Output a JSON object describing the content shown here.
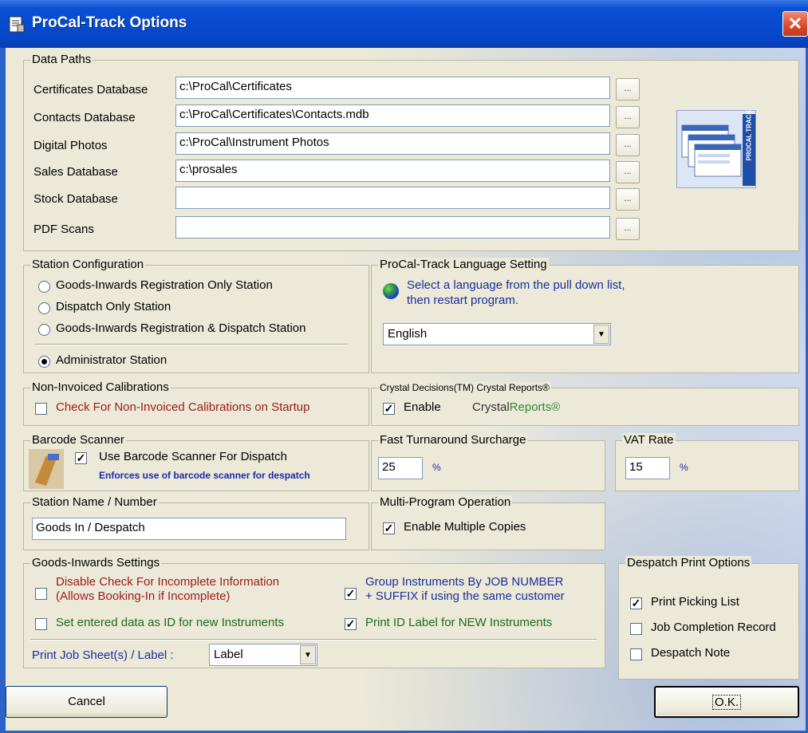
{
  "window": {
    "title": "ProCal-Track Options",
    "title_icon": "doc-icon",
    "close_glyph": "✕"
  },
  "data_paths": {
    "title": "Data Paths",
    "rows": [
      {
        "label": "Certificates Database",
        "value": "c:\\ProCal\\Certificates",
        "browse": "..."
      },
      {
        "label": "Contacts Database",
        "value": "c:\\ProCal\\Certificates\\Contacts.mdb",
        "browse": "..."
      },
      {
        "label": "Digital Photos",
        "value": "c:\\ProCal\\Instrument Photos",
        "browse": "..."
      },
      {
        "label": "Sales Database",
        "value": "c:\\prosales",
        "browse": "..."
      },
      {
        "label": "Stock Database",
        "value": "",
        "browse": "..."
      },
      {
        "label": "PDF Scans",
        "value": "",
        "browse": "..."
      }
    ],
    "logo_text": "PROCAL TRACK"
  },
  "station_config": {
    "title": "Station Configuration",
    "options": [
      {
        "label": "Goods-Inwards Registration Only Station",
        "selected": false
      },
      {
        "label": "Dispatch Only Station",
        "selected": false
      },
      {
        "label": "Goods-Inwards Registration & Dispatch Station",
        "selected": false
      },
      {
        "label": "Administrator Station",
        "selected": true
      }
    ]
  },
  "language": {
    "title": "ProCal-Track Language Setting",
    "hint_line1": "Select a language from the pull down list,",
    "hint_line2": "then restart program.",
    "selected": "English"
  },
  "non_invoiced": {
    "title": "Non-Invoiced Calibrations",
    "check_label": "Check For Non-Invoiced Calibrations on Startup",
    "checked": false
  },
  "crystal": {
    "title": "Crystal Decisions(TM) Crystal Reports®",
    "enable_label": "Enable",
    "enabled": true,
    "brand_part1": "Crystal",
    "brand_part2": "Reports®"
  },
  "barcode": {
    "title": "Barcode Scanner",
    "check_label": "Use Barcode Scanner For Dispatch",
    "checked": true,
    "note": "Enforces use of barcode scanner for despatch"
  },
  "surcharge": {
    "title": "Fast Turnaround Surcharge",
    "value": "25",
    "unit": "%"
  },
  "vat": {
    "title": "VAT Rate",
    "value": "15",
    "unit": "%"
  },
  "station_name": {
    "title": "Station Name / Number",
    "value": "Goods In / Despatch"
  },
  "multi_program": {
    "title": "Multi-Program Operation",
    "check_label": "Enable Multiple Copies",
    "checked": true
  },
  "goods_inwards": {
    "title": "Goods-Inwards Settings",
    "disable_check_line1": "Disable Check For Incomplete Information",
    "disable_check_line2": "(Allows Booking-In if Incomplete)",
    "disable_checked": false,
    "set_entered_label": "Set entered data as ID for new Instruments",
    "set_entered_checked": false,
    "group_line1": "Group Instruments By JOB  NUMBER",
    "group_line2": "+ SUFFIX if using the same customer",
    "group_checked": true,
    "print_id_label": "Print ID Label for NEW Instruments",
    "print_id_checked": true,
    "print_job_label": "Print Job Sheet(s) / Label :",
    "print_job_value": "Label"
  },
  "despatch_print": {
    "title": "Despatch Print Options",
    "options": [
      {
        "label": "Print Picking List",
        "checked": true
      },
      {
        "label": "Job Completion Record",
        "checked": false
      },
      {
        "label": "Despatch Note",
        "checked": false
      }
    ]
  },
  "buttons": {
    "cancel": "Cancel",
    "ok": "O.K."
  },
  "colors": {
    "title_bar": "#0646c8",
    "dialog_bg": "#ece9d8",
    "warning_text": "#9b1b1b",
    "green_text": "#1e6b1e",
    "blue_text": "#1a2e9b"
  }
}
